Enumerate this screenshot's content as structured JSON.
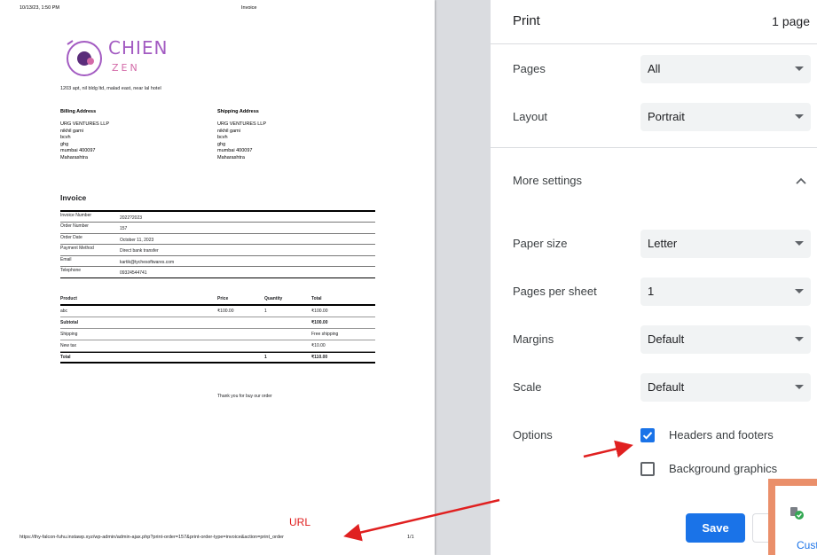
{
  "preview": {
    "header_date": "10/13/23, 1:50 PM",
    "header_title": "Invoice",
    "logo": {
      "brand": "CHIEN",
      "sub": "ZEN"
    },
    "store_address": "1203 apt, nil bldg ltd, malad east, near lal hotel",
    "billing": {
      "title": "Billing Address",
      "lines": [
        "URG VENTURES LLP",
        "nikhil gami",
        "bcvh",
        "ghg",
        "mumbai 400097",
        "Maharashtra"
      ]
    },
    "shipping": {
      "title": "Shipping Address",
      "lines": [
        "URG VENTURES LLP",
        "nikhil gami",
        "bcvh",
        "ghg",
        "mumbai 400097",
        "Maharashtra"
      ]
    },
    "invoice_heading": "Invoice",
    "invoice_rows": [
      {
        "k": "Invoice Number",
        "v": "2022?2023"
      },
      {
        "k": "Order Number",
        "v": "157"
      },
      {
        "k": "Order Date",
        "v": "October 11, 2023"
      },
      {
        "k": "Payment Method",
        "v": "Direct bank transfer"
      },
      {
        "k": "Email",
        "v": "kartik@tychesoftwares.com"
      },
      {
        "k": "Telephone",
        "v": "09324544741"
      }
    ],
    "products": {
      "headers": [
        "Product",
        "Price",
        "Quantity",
        "Total"
      ],
      "rows": [
        [
          "abc",
          "₹100.00",
          "1",
          "₹100.00"
        ],
        [
          "Subtotal",
          "",
          "",
          "₹100.00"
        ],
        [
          "Shipping",
          "",
          "",
          "Free shipping"
        ],
        [
          "New tax",
          "",
          "",
          "₹10.00"
        ],
        [
          "Total",
          "",
          "1",
          "₹110.00"
        ]
      ]
    },
    "thanks": "Thank you for buy our order",
    "footer_url": "https://thy-falcon-fuhu.instawp.xyz/wp-admin/admin-ajax.php?print-order=157&print-order-type=invoice&action=print_order",
    "footer_page": "1/1",
    "annotation_label": "URL"
  },
  "print_panel": {
    "title": "Print",
    "page_count": "1 page",
    "pages": {
      "label": "Pages",
      "value": "All"
    },
    "layout": {
      "label": "Layout",
      "value": "Portrait"
    },
    "more_settings": "More settings",
    "paper_size": {
      "label": "Paper size",
      "value": "Letter"
    },
    "pages_per_sheet": {
      "label": "Pages per sheet",
      "value": "1"
    },
    "margins": {
      "label": "Margins",
      "value": "Default"
    },
    "scale": {
      "label": "Scale",
      "value": "Default"
    },
    "options": {
      "label": "Options",
      "headers_footers": {
        "label": "Headers and footers",
        "checked": true
      },
      "background_graphics": {
        "label": "Background graphics",
        "checked": false
      }
    },
    "save_label": "Save"
  },
  "popup": {
    "text": "Cust"
  },
  "colors": {
    "accent": "#1a73e8",
    "annotation": "#e02020",
    "popup_border": "#ea8f6a"
  }
}
